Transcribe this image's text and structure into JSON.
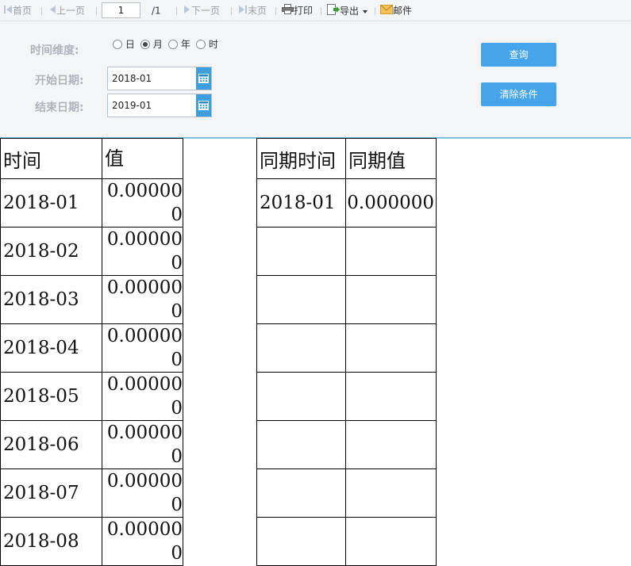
{
  "toolbar": {
    "first": "首页",
    "prev": "上一页",
    "page": "1",
    "total": "/1",
    "next": "下一页",
    "last": "末页",
    "print": "打印",
    "export": "导出",
    "mail": "邮件"
  },
  "filters": {
    "dimension_label": "时间维度:",
    "options": [
      "日",
      "月",
      "年",
      "时"
    ],
    "selected_option": "月",
    "start_label": "开始日期:",
    "start_value": "2018-01",
    "end_label": "结束日期:",
    "end_value": "2019-01",
    "query_button": "查询",
    "clear_button": "清除条件"
  },
  "table1": {
    "headers": [
      "时间",
      "值"
    ],
    "rows": [
      {
        "time": "2018-01",
        "value": "0.000000"
      },
      {
        "time": "2018-02",
        "value": "0.000000"
      },
      {
        "time": "2018-03",
        "value": "0.000000"
      },
      {
        "time": "2018-04",
        "value": "0.000000"
      },
      {
        "time": "2018-05",
        "value": "0.000000"
      },
      {
        "time": "2018-06",
        "value": "0.000000"
      },
      {
        "time": "2018-07",
        "value": "0.000000"
      },
      {
        "time": "2018-08",
        "value": "0.000000"
      }
    ]
  },
  "table2": {
    "headers": [
      "同期时间",
      "同期值"
    ],
    "rows": [
      {
        "time": "2018-01",
        "value": "0.000000"
      },
      {
        "time": "",
        "value": ""
      },
      {
        "time": "",
        "value": ""
      },
      {
        "time": "",
        "value": ""
      },
      {
        "time": "",
        "value": ""
      },
      {
        "time": "",
        "value": ""
      },
      {
        "time": "",
        "value": ""
      },
      {
        "time": "",
        "value": ""
      }
    ]
  },
  "colors": {
    "accent": "#46a5ea",
    "panel_bg": "#f4f5f7",
    "divider": "#7ec0dd"
  }
}
